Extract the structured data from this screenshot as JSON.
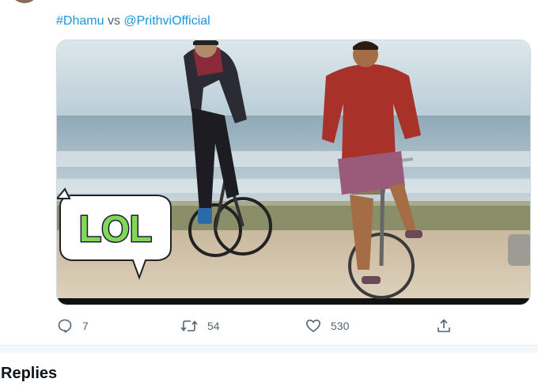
{
  "tweet": {
    "hashtag": "#Dhamu",
    "connector": "vs",
    "mention": "@PrithviOfficial",
    "media": {
      "description_label": "LOL",
      "sticker_color": "#7fd957"
    }
  },
  "actions": {
    "reply_count": "7",
    "retweet_count": "54",
    "like_count": "530"
  },
  "replies_heading": "Replies",
  "colors": {
    "link": "#1b95e0",
    "muted": "#536471"
  }
}
